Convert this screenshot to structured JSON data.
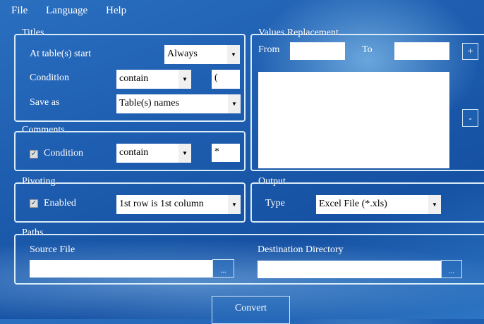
{
  "menu": {
    "file": "File",
    "language": "Language",
    "help": "Help"
  },
  "titles": {
    "legend": "Titles",
    "at_start_label": "At table(s) start",
    "at_start_value": "Always",
    "condition_label": "Condition",
    "condition_value": "contain",
    "condition_text": "(",
    "save_as_label": "Save as",
    "save_as_value": "Table(s) names"
  },
  "comments": {
    "legend": "Comments",
    "condition_label": "Condition",
    "condition_checked": true,
    "condition_value": "contain",
    "condition_text": "*"
  },
  "pivoting": {
    "legend": "Pivoting",
    "enabled_label": "Enabled",
    "enabled_checked": true,
    "mode_value": "1st row is 1st column"
  },
  "values_replacement": {
    "legend": "Values Replacement",
    "from_label": "From",
    "from_value": "",
    "to_label": "To",
    "to_value": "",
    "add_label": "+",
    "remove_label": "-"
  },
  "output": {
    "legend": "Output",
    "type_label": "Type",
    "type_value": "Excel File (*.xls)"
  },
  "paths": {
    "legend": "Paths",
    "source_label": "Source File",
    "source_value": "",
    "source_browse": "...",
    "dest_label": "Destination Directory",
    "dest_value": "",
    "dest_browse": "..."
  },
  "convert_label": "Convert",
  "icons": {
    "dropdown": "chevron-down-icon",
    "check": "checkmark-icon"
  }
}
